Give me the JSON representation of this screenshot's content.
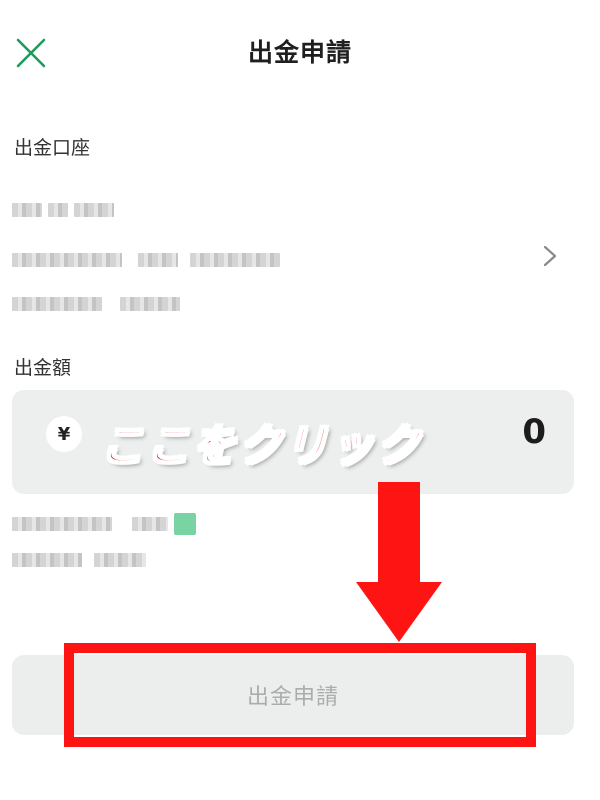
{
  "header": {
    "title": "出金申請",
    "close_icon": "close-icon"
  },
  "account_section": {
    "label": "出金口座",
    "chevron_icon": "chevron-right-icon"
  },
  "amount_section": {
    "label": "出金額",
    "currency_symbol": "¥",
    "value": "0"
  },
  "annotation": {
    "text": "ここをクリック",
    "color": "#f01a1a"
  },
  "submit": {
    "label": "出金申請"
  },
  "colors": {
    "accent": "#1e9b5c",
    "annotation_red": "#ff1414",
    "input_bg": "#ecefee"
  }
}
